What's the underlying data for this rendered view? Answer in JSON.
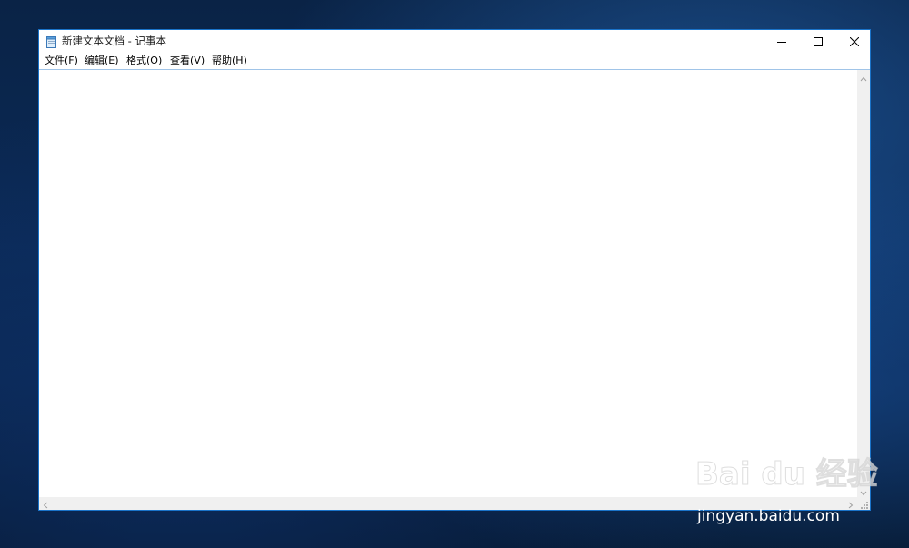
{
  "window": {
    "title": "新建文本文档 - 记事本",
    "app_icon": "notepad-icon",
    "caption_buttons": {
      "minimize_icon": "minimize-icon",
      "maximize_icon": "maximize-icon",
      "close_icon": "close-icon"
    }
  },
  "menu": {
    "items": [
      {
        "label": "文件(F)"
      },
      {
        "label": "编辑(E)"
      },
      {
        "label": "格式(O)"
      },
      {
        "label": "查看(V)"
      },
      {
        "label": "帮助(H)"
      }
    ]
  },
  "editor": {
    "content": ""
  },
  "scrollbars": {
    "up_icon": "chevron-up-icon",
    "down_icon": "chevron-down-icon",
    "left_icon": "chevron-left-icon",
    "right_icon": "chevron-right-icon"
  },
  "watermark": {
    "logo_text": "Bai du 经验",
    "url": "jingyan.baidu.com"
  },
  "colors": {
    "window_border": "#1a73c9",
    "scrollbar_bg": "#f0f0f0",
    "desktop_bg": "#0a2750"
  }
}
